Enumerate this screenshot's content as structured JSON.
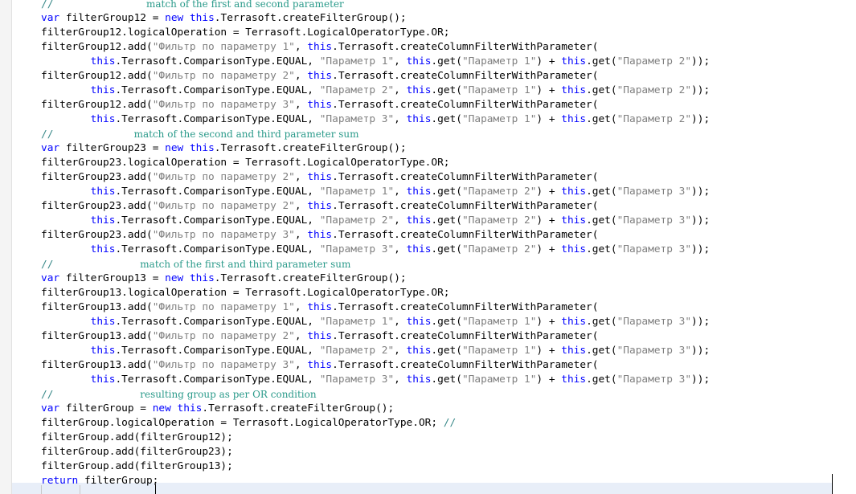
{
  "editor": {
    "lines": [
      [
        {
          "c": "cm",
          "t": "//"
        },
        {
          "c": "pad",
          "t": "               "
        },
        {
          "c": "note",
          "t": "match of the first and second parameter"
        }
      ],
      [
        {
          "c": "kw",
          "t": "var"
        },
        {
          "c": "",
          "t": " filterGroup12 = "
        },
        {
          "c": "kw",
          "t": "new"
        },
        {
          "c": "",
          "t": " "
        },
        {
          "c": "kw",
          "t": "this"
        },
        {
          "c": "",
          "t": ".Terrasoft.createFilterGroup();"
        }
      ],
      [
        {
          "c": "",
          "t": "filterGroup12.logicalOperation = Terrasoft.LogicalOperatorType.OR;"
        }
      ],
      [
        {
          "c": "",
          "t": "filterGroup12.add("
        },
        {
          "c": "str",
          "t": "\"Фильтр по параметру 1\""
        },
        {
          "c": "",
          "t": ", "
        },
        {
          "c": "kw",
          "t": "this"
        },
        {
          "c": "",
          "t": ".Terrasoft.createColumnFilterWithParameter("
        }
      ],
      [
        {
          "c": "",
          "t": "        "
        },
        {
          "c": "kw",
          "t": "this"
        },
        {
          "c": "",
          "t": ".Terrasoft.ComparisonType.EQUAL, "
        },
        {
          "c": "str",
          "t": "\"Параметр 1\""
        },
        {
          "c": "",
          "t": ", "
        },
        {
          "c": "kw",
          "t": "this"
        },
        {
          "c": "",
          "t": ".get("
        },
        {
          "c": "str",
          "t": "\"Параметр 1\""
        },
        {
          "c": "",
          "t": ") + "
        },
        {
          "c": "kw",
          "t": "this"
        },
        {
          "c": "",
          "t": ".get("
        },
        {
          "c": "str",
          "t": "\"Параметр 2\""
        },
        {
          "c": "",
          "t": "));"
        }
      ],
      [
        {
          "c": "",
          "t": "filterGroup12.add("
        },
        {
          "c": "str",
          "t": "\"Фильтр по параметру 2\""
        },
        {
          "c": "",
          "t": ", "
        },
        {
          "c": "kw",
          "t": "this"
        },
        {
          "c": "",
          "t": ".Terrasoft.createColumnFilterWithParameter("
        }
      ],
      [
        {
          "c": "",
          "t": "        "
        },
        {
          "c": "kw",
          "t": "this"
        },
        {
          "c": "",
          "t": ".Terrasoft.ComparisonType.EQUAL, "
        },
        {
          "c": "str",
          "t": "\"Параметр 2\""
        },
        {
          "c": "",
          "t": ", "
        },
        {
          "c": "kw",
          "t": "this"
        },
        {
          "c": "",
          "t": ".get("
        },
        {
          "c": "str",
          "t": "\"Параметр 1\""
        },
        {
          "c": "",
          "t": ") + "
        },
        {
          "c": "kw",
          "t": "this"
        },
        {
          "c": "",
          "t": ".get("
        },
        {
          "c": "str",
          "t": "\"Параметр 2\""
        },
        {
          "c": "",
          "t": "));"
        }
      ],
      [
        {
          "c": "",
          "t": "filterGroup12.add("
        },
        {
          "c": "str",
          "t": "\"Фильтр по параметру 3\""
        },
        {
          "c": "",
          "t": ", "
        },
        {
          "c": "kw",
          "t": "this"
        },
        {
          "c": "",
          "t": ".Terrasoft.createColumnFilterWithParameter("
        }
      ],
      [
        {
          "c": "",
          "t": "        "
        },
        {
          "c": "kw",
          "t": "this"
        },
        {
          "c": "",
          "t": ".Terrasoft.ComparisonType.EQUAL, "
        },
        {
          "c": "str",
          "t": "\"Параметр 3\""
        },
        {
          "c": "",
          "t": ", "
        },
        {
          "c": "kw",
          "t": "this"
        },
        {
          "c": "",
          "t": ".get("
        },
        {
          "c": "str",
          "t": "\"Параметр 1\""
        },
        {
          "c": "",
          "t": ") + "
        },
        {
          "c": "kw",
          "t": "this"
        },
        {
          "c": "",
          "t": ".get("
        },
        {
          "c": "str",
          "t": "\"Параметр 2\""
        },
        {
          "c": "",
          "t": "));"
        }
      ],
      [
        {
          "c": "cm",
          "t": "//"
        },
        {
          "c": "pad",
          "t": "             "
        },
        {
          "c": "note",
          "t": "match of the second and third parameter sum"
        }
      ],
      [
        {
          "c": "kw",
          "t": "var"
        },
        {
          "c": "",
          "t": " filterGroup23 = "
        },
        {
          "c": "kw",
          "t": "new"
        },
        {
          "c": "",
          "t": " "
        },
        {
          "c": "kw",
          "t": "this"
        },
        {
          "c": "",
          "t": ".Terrasoft.createFilterGroup();"
        }
      ],
      [
        {
          "c": "",
          "t": "filterGroup23.logicalOperation = Terrasoft.LogicalOperatorType.OR;"
        }
      ],
      [
        {
          "c": "",
          "t": "filterGroup23.add("
        },
        {
          "c": "str",
          "t": "\"Фильтр по параметру 2\""
        },
        {
          "c": "",
          "t": ", "
        },
        {
          "c": "kw",
          "t": "this"
        },
        {
          "c": "",
          "t": ".Terrasoft.createColumnFilterWithParameter("
        }
      ],
      [
        {
          "c": "",
          "t": "        "
        },
        {
          "c": "kw",
          "t": "this"
        },
        {
          "c": "",
          "t": ".Terrasoft.ComparisonType.EQUAL, "
        },
        {
          "c": "str",
          "t": "\"Параметр 1\""
        },
        {
          "c": "",
          "t": ", "
        },
        {
          "c": "kw",
          "t": "this"
        },
        {
          "c": "",
          "t": ".get("
        },
        {
          "c": "str",
          "t": "\"Параметр 2\""
        },
        {
          "c": "",
          "t": ") + "
        },
        {
          "c": "kw",
          "t": "this"
        },
        {
          "c": "",
          "t": ".get("
        },
        {
          "c": "str",
          "t": "\"Параметр 3\""
        },
        {
          "c": "",
          "t": "));"
        }
      ],
      [
        {
          "c": "",
          "t": "filterGroup23.add("
        },
        {
          "c": "str",
          "t": "\"Фильтр по параметру 2\""
        },
        {
          "c": "",
          "t": ", "
        },
        {
          "c": "kw",
          "t": "this"
        },
        {
          "c": "",
          "t": ".Terrasoft.createColumnFilterWithParameter("
        }
      ],
      [
        {
          "c": "",
          "t": "        "
        },
        {
          "c": "kw",
          "t": "this"
        },
        {
          "c": "",
          "t": ".Terrasoft.ComparisonType.EQUAL, "
        },
        {
          "c": "str",
          "t": "\"Параметр 2\""
        },
        {
          "c": "",
          "t": ", "
        },
        {
          "c": "kw",
          "t": "this"
        },
        {
          "c": "",
          "t": ".get("
        },
        {
          "c": "str",
          "t": "\"Параметр 2\""
        },
        {
          "c": "",
          "t": ") + "
        },
        {
          "c": "kw",
          "t": "this"
        },
        {
          "c": "",
          "t": ".get("
        },
        {
          "c": "str",
          "t": "\"Параметр 3\""
        },
        {
          "c": "",
          "t": "));"
        }
      ],
      [
        {
          "c": "",
          "t": "filterGroup23.add("
        },
        {
          "c": "str",
          "t": "\"Фильтр по параметру 3\""
        },
        {
          "c": "",
          "t": ", "
        },
        {
          "c": "kw",
          "t": "this"
        },
        {
          "c": "",
          "t": ".Terrasoft.createColumnFilterWithParameter("
        }
      ],
      [
        {
          "c": "",
          "t": "        "
        },
        {
          "c": "kw",
          "t": "this"
        },
        {
          "c": "",
          "t": ".Terrasoft.ComparisonType.EQUAL, "
        },
        {
          "c": "str",
          "t": "\"Параметр 3\""
        },
        {
          "c": "",
          "t": ", "
        },
        {
          "c": "kw",
          "t": "this"
        },
        {
          "c": "",
          "t": ".get("
        },
        {
          "c": "str",
          "t": "\"Параметр 2\""
        },
        {
          "c": "",
          "t": ") + "
        },
        {
          "c": "kw",
          "t": "this"
        },
        {
          "c": "",
          "t": ".get("
        },
        {
          "c": "str",
          "t": "\"Параметр 3\""
        },
        {
          "c": "",
          "t": "));"
        }
      ],
      [
        {
          "c": "cm",
          "t": "//"
        },
        {
          "c": "pad",
          "t": "              "
        },
        {
          "c": "note",
          "t": "match of the first and third parameter sum"
        }
      ],
      [
        {
          "c": "kw",
          "t": "var"
        },
        {
          "c": "",
          "t": " filterGroup13 = "
        },
        {
          "c": "kw",
          "t": "new"
        },
        {
          "c": "",
          "t": " "
        },
        {
          "c": "kw",
          "t": "this"
        },
        {
          "c": "",
          "t": ".Terrasoft.createFilterGroup();"
        }
      ],
      [
        {
          "c": "",
          "t": "filterGroup13.logicalOperation = Terrasoft.LogicalOperatorType.OR;"
        }
      ],
      [
        {
          "c": "",
          "t": "filterGroup13.add("
        },
        {
          "c": "str",
          "t": "\"Фильтр по параметру 1\""
        },
        {
          "c": "",
          "t": ", "
        },
        {
          "c": "kw",
          "t": "this"
        },
        {
          "c": "",
          "t": ".Terrasoft.createColumnFilterWithParameter("
        }
      ],
      [
        {
          "c": "",
          "t": "        "
        },
        {
          "c": "kw",
          "t": "this"
        },
        {
          "c": "",
          "t": ".Terrasoft.ComparisonType.EQUAL, "
        },
        {
          "c": "str",
          "t": "\"Параметр 1\""
        },
        {
          "c": "",
          "t": ", "
        },
        {
          "c": "kw",
          "t": "this"
        },
        {
          "c": "",
          "t": ".get("
        },
        {
          "c": "str",
          "t": "\"Параметр 1\""
        },
        {
          "c": "",
          "t": ") + "
        },
        {
          "c": "kw",
          "t": "this"
        },
        {
          "c": "",
          "t": ".get("
        },
        {
          "c": "str",
          "t": "\"Параметр 3\""
        },
        {
          "c": "",
          "t": "));"
        }
      ],
      [
        {
          "c": "",
          "t": "filterGroup13.add("
        },
        {
          "c": "str",
          "t": "\"Фильтр по параметру 2\""
        },
        {
          "c": "",
          "t": ", "
        },
        {
          "c": "kw",
          "t": "this"
        },
        {
          "c": "",
          "t": ".Terrasoft.createColumnFilterWithParameter("
        }
      ],
      [
        {
          "c": "",
          "t": "        "
        },
        {
          "c": "kw",
          "t": "this"
        },
        {
          "c": "",
          "t": ".Terrasoft.ComparisonType.EQUAL, "
        },
        {
          "c": "str",
          "t": "\"Параметр 2\""
        },
        {
          "c": "",
          "t": ", "
        },
        {
          "c": "kw",
          "t": "this"
        },
        {
          "c": "",
          "t": ".get("
        },
        {
          "c": "str",
          "t": "\"Параметр 1\""
        },
        {
          "c": "",
          "t": ") + "
        },
        {
          "c": "kw",
          "t": "this"
        },
        {
          "c": "",
          "t": ".get("
        },
        {
          "c": "str",
          "t": "\"Параметр 3\""
        },
        {
          "c": "",
          "t": "));"
        }
      ],
      [
        {
          "c": "",
          "t": "filterGroup13.add("
        },
        {
          "c": "str",
          "t": "\"Фильтр по параметру 3\""
        },
        {
          "c": "",
          "t": ", "
        },
        {
          "c": "kw",
          "t": "this"
        },
        {
          "c": "",
          "t": ".Terrasoft.createColumnFilterWithParameter("
        }
      ],
      [
        {
          "c": "",
          "t": "        "
        },
        {
          "c": "kw",
          "t": "this"
        },
        {
          "c": "",
          "t": ".Terrasoft.ComparisonType.EQUAL, "
        },
        {
          "c": "str",
          "t": "\"Параметр 3\""
        },
        {
          "c": "",
          "t": ", "
        },
        {
          "c": "kw",
          "t": "this"
        },
        {
          "c": "",
          "t": ".get("
        },
        {
          "c": "str",
          "t": "\"Параметр 1\""
        },
        {
          "c": "",
          "t": ") + "
        },
        {
          "c": "kw",
          "t": "this"
        },
        {
          "c": "",
          "t": ".get("
        },
        {
          "c": "str",
          "t": "\"Параметр 3\""
        },
        {
          "c": "",
          "t": "));"
        }
      ],
      [
        {
          "c": "cm",
          "t": "//"
        },
        {
          "c": "pad",
          "t": "              "
        },
        {
          "c": "note",
          "t": "resulting group as per OR condition"
        }
      ],
      [
        {
          "c": "kw",
          "t": "var"
        },
        {
          "c": "",
          "t": " filterGroup = "
        },
        {
          "c": "kw",
          "t": "new"
        },
        {
          "c": "",
          "t": " "
        },
        {
          "c": "kw",
          "t": "this"
        },
        {
          "c": "",
          "t": ".Terrasoft.createFilterGroup();"
        }
      ],
      [
        {
          "c": "",
          "t": "filterGroup.logicalOperation = Terrasoft.LogicalOperatorType.OR; "
        },
        {
          "c": "cm",
          "t": "//"
        }
      ],
      [
        {
          "c": "",
          "t": "filterGroup.add(filterGroup12);"
        }
      ],
      [
        {
          "c": "",
          "t": "filterGroup.add(filterGroup23);"
        }
      ],
      [
        {
          "c": "",
          "t": "filterGroup.add(filterGroup13);"
        }
      ],
      [
        {
          "c": "kw",
          "t": "return"
        },
        {
          "c": "",
          "t": " filterGroup;"
        }
      ]
    ],
    "colors": {
      "keyword": "#0000ff",
      "string": "#808080",
      "comment": "#3a8a8a",
      "note": "#2a9a8a",
      "text": "#000000"
    }
  }
}
